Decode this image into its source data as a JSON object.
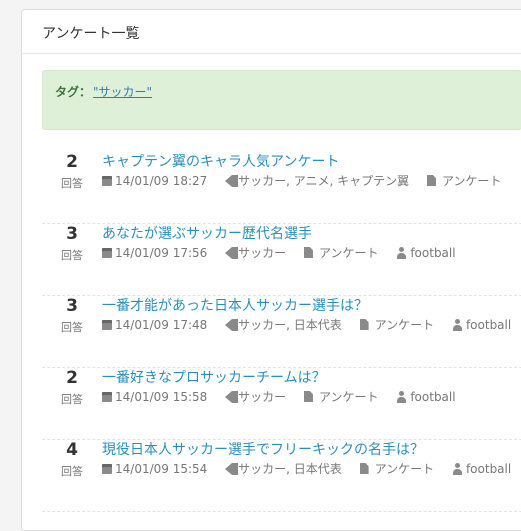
{
  "panel": {
    "title": "アンケート一覧"
  },
  "tag_filter": {
    "label": "タグ：",
    "value": "\"サッカー\""
  },
  "items": [
    {
      "count": "2",
      "count_label": "回答",
      "title": "キャプテン翼のキャラ人気アンケート",
      "date": "14/01/09 18:27",
      "tags": "サッカー, アニメ, キャプテン翼",
      "category": "アンケート",
      "user": ""
    },
    {
      "count": "3",
      "count_label": "回答",
      "title": "あなたが選ぶサッカー歴代名選手",
      "date": "14/01/09 17:56",
      "tags": "サッカー",
      "category": "アンケート",
      "user": "football"
    },
    {
      "count": "3",
      "count_label": "回答",
      "title": "一番才能があった日本人サッカー選手は？",
      "date": "14/01/09 17:48",
      "tags": "サッカー, 日本代表",
      "category": "アンケート",
      "user": "football"
    },
    {
      "count": "2",
      "count_label": "回答",
      "title": "一番好きなプロサッカーチームは？",
      "date": "14/01/09 15:58",
      "tags": "サッカー",
      "category": "アンケート",
      "user": "football"
    },
    {
      "count": "4",
      "count_label": "回答",
      "title": "現役日本人サッカー選手でフリーキックの名手は？",
      "date": "14/01/09 15:54",
      "tags": "サッカー, 日本代表",
      "category": "アンケート",
      "user": "football"
    }
  ],
  "colors": {
    "link": "#2a8fbd",
    "tag_box_bg": "#dff0d8",
    "tag_box_text": "#3c763d"
  }
}
